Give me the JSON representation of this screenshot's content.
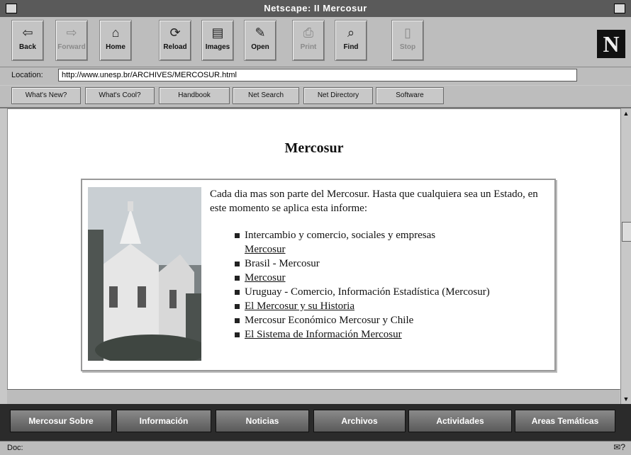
{
  "window": {
    "title": "Netscape: II Mercosur"
  },
  "toolbar": {
    "buttons": [
      {
        "label": "Back",
        "icon": "back-arrow-icon",
        "glyph": "⇦"
      },
      {
        "label": "Forward",
        "icon": "forward-arrow-icon",
        "glyph": "⇨"
      },
      {
        "label": "Home",
        "icon": "home-icon",
        "glyph": "⌂"
      },
      {
        "label": "Reload",
        "icon": "reload-icon",
        "glyph": "⟳"
      },
      {
        "label": "Images",
        "icon": "images-icon",
        "glyph": "▤"
      },
      {
        "label": "Open",
        "icon": "open-icon",
        "glyph": "✎"
      },
      {
        "label": "Print",
        "icon": "print-icon",
        "glyph": "⎙"
      },
      {
        "label": "Find",
        "icon": "find-icon",
        "glyph": "⌕"
      },
      {
        "label": "Stop",
        "icon": "stop-icon",
        "glyph": "▯"
      }
    ],
    "logo": "N"
  },
  "location": {
    "label": "Location:",
    "value": "http://www.unesp.br/ARCHIVES/MERCOSUR.html"
  },
  "directory_buttons": [
    "What's New?",
    "What's Cool?",
    "Handbook",
    "Net Search",
    "Net Directory",
    "Software"
  ],
  "page": {
    "title": "Mercosur",
    "intro": "Cada dia mas son parte del Mercosur. Hasta que cualquiera sea un Estado, en este momento se aplica esta informe:",
    "items": [
      {
        "text": "Intercambio y comercio, sociales y empresas",
        "link": "Mercosur"
      },
      {
        "text": "Brasil - Mercosur",
        "link": ""
      },
      {
        "text": "",
        "link": "Mercosur"
      },
      {
        "text": "Uruguay - Comercio, Información Estadística (Mercosur)",
        "link": ""
      },
      {
        "text": "",
        "link": "El Mercosur y su Historia"
      },
      {
        "text": "Mercosur Económico Mercosur y Chile",
        "link": ""
      },
      {
        "text": "",
        "link": "El Sistema de Información Mercosur"
      }
    ]
  },
  "bottom_nav": [
    "Mercosur Sobre",
    "Información",
    "Noticias",
    "Archivos",
    "Actividades",
    "Areas Temáticas"
  ],
  "status": {
    "left": "Doc:",
    "right": "✉?"
  }
}
